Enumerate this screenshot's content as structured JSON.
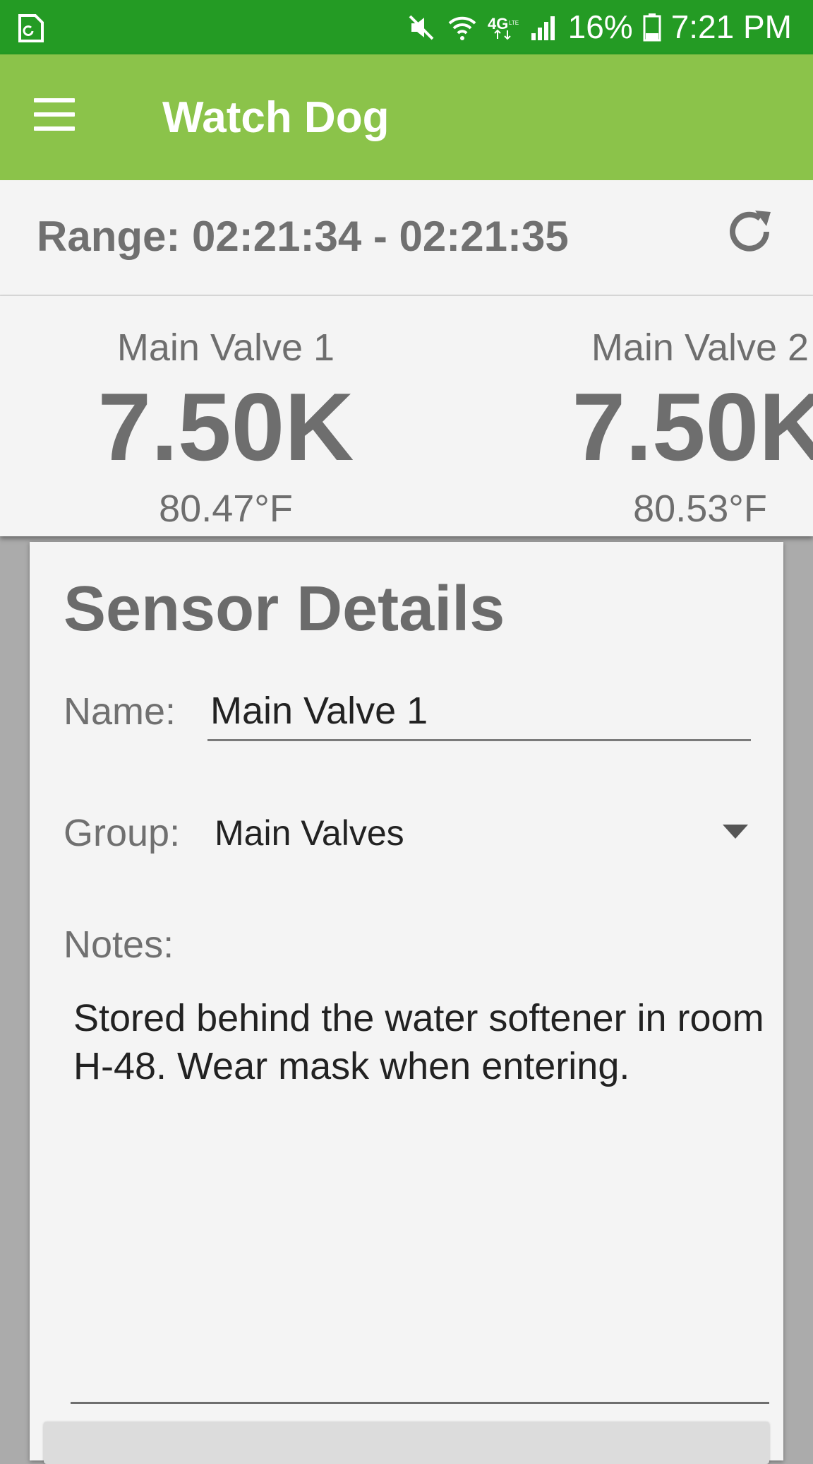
{
  "status_bar": {
    "battery_percent": "16%",
    "time": "7:21 PM",
    "network": "4G",
    "network_sub": "LTE",
    "icons": [
      "screen-capture-icon",
      "mute-icon",
      "wifi-icon",
      "network-4g-lte-icon",
      "signal-icon",
      "battery-icon"
    ]
  },
  "app_bar": {
    "title": "Watch Dog",
    "menu_icon": "hamburger-menu-icon",
    "color": "#8bc34a"
  },
  "range": {
    "text": "Range: 02:21:34 - 02:21:35",
    "refresh_icon": "refresh-icon"
  },
  "sensors": [
    {
      "name": "Main Valve 1",
      "value": "7.50K",
      "temperature": "80.47°F"
    },
    {
      "name": "Main Valve 2",
      "value": "7.50K",
      "temperature": "80.53°F"
    }
  ],
  "sensor_details": {
    "title": "Sensor Details",
    "name_label": "Name:",
    "name_value": "Main Valve 1",
    "group_label": "Group:",
    "group_value": "Main Valves",
    "notes_label": "Notes:",
    "notes_value": "Stored behind the water softener in room H-48. Wear mask when entering."
  },
  "colors": {
    "status_bar": "#249b24",
    "app_bar": "#8bc34a",
    "panel": "#f4f4f4",
    "text_gray": "#6e6e6e"
  }
}
